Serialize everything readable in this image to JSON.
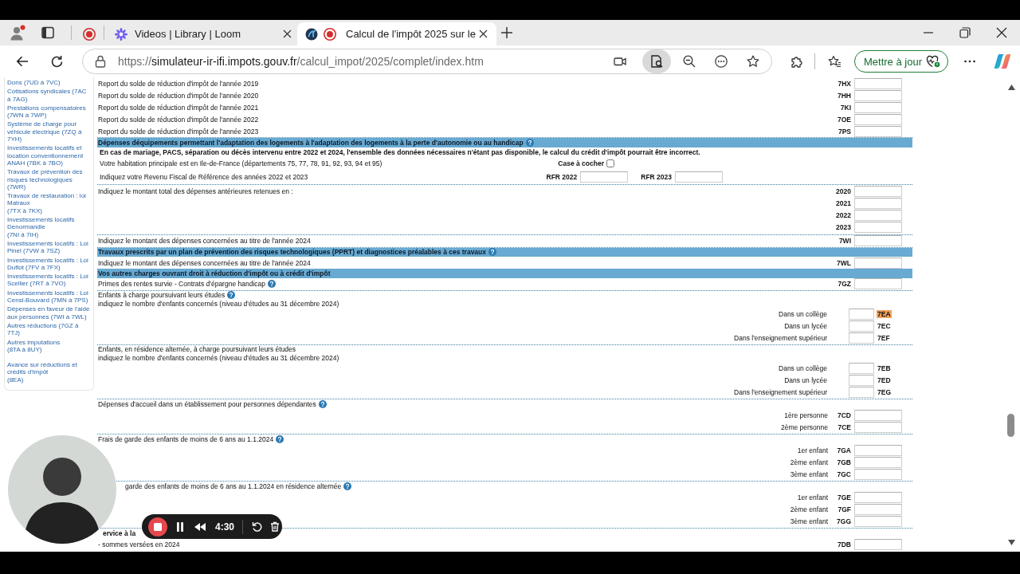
{
  "browser": {
    "tabs": [
      {
        "kind": "pinned",
        "recording": true,
        "selected": false
      },
      {
        "kind": "page",
        "title": "Videos | Library | Loom",
        "recording": false,
        "selected": false
      },
      {
        "kind": "page",
        "title": "Calcul de l'impôt 2025 sur le",
        "recording": true,
        "selected": true
      }
    ],
    "url": {
      "scheme": "https://",
      "host": "simulateur-ir-ifi.impots.gouv.fr",
      "path": "/calcul_impot/2025/complet/index.htm"
    },
    "update_button": "Mettre à jour"
  },
  "sidebar": {
    "sections": [
      {
        "items": [
          "Dons (7UD à 7VC)",
          "Cotisations syndicales (7AC à 7AG)",
          "Prestations compensatoires (7WN à 7WP)",
          "Système de charge pour véhicule électrique (7ZQ à 7YH)",
          "Investissements locatifs et location conventionnement ANAH (7BK à 7BO)",
          "Travaux de prévention des risques technologiques (7WR)",
          "Travaux de restauration : loi Malraux\n(7TX à 7KX)",
          "Investissements locatifs Denormandie\n(7NI à 7IH)",
          "Investissements locatifs : Loi Pinel (7VW à 7SZ)",
          "Investissements locatifs : Loi Duflot (7FV à 7FX)",
          "Investissements locatifs : Loi Scellier (7RT à 7VO)",
          "Investissements locatifs : Loi Censi-Bouvard (7MN à 7PS)",
          "Dépenses en faveur de l'aide aux personnes (7WI à 7WL)",
          "Autres réductions (7GZ à 7TJ)",
          "Autres imputations\n(8TA à 8UY)"
        ]
      },
      {
        "items": [
          "Avance sur réductions et crédits d'impôt\n(8EA)"
        ]
      }
    ]
  },
  "form": {
    "groups": [
      {
        "rows": [
          {
            "kind": "field",
            "label": "Report du solde de réduction d'impôt de l'année 2019",
            "code": "7HX"
          },
          {
            "kind": "field",
            "label": "Report du solde de réduction d'impôt de l'année 2020",
            "code": "7HH"
          },
          {
            "kind": "field",
            "label": "Report du solde de réduction d'impôt de l'année 2021",
            "code": "7KI"
          },
          {
            "kind": "field",
            "label": "Report du solde de réduction d'impôt de l'année 2022",
            "code": "7OE"
          },
          {
            "kind": "field",
            "label": "Report du solde de réduction d'impôt de l'année 2023",
            "code": "7PS"
          }
        ]
      },
      {
        "rows": [
          {
            "kind": "header",
            "title": "Dépenses déquipements permettant l'adaptation des logements à l'adaptation des logements à la perte d'autonomie ou au handicap",
            "help": true
          },
          {
            "kind": "notice",
            "text": "En cas de mariage, PACS, séparation ou décès intervenu entre 2022 et 2024, l'ensemble des données nécessaires n'étant pas disponible, le calcul du crédit d'impôt pourrait être incorrect."
          },
          {
            "kind": "checkbox",
            "label": "Votre habitation principale est en Ile-de-France (départements 75, 77, 78, 91, 92, 93, 94 et 95)",
            "checkbox_label": "Case à cocher",
            "checked": false
          },
          {
            "kind": "rfr",
            "label": "Indiquez votre Revenu Fiscal de Référence des années 2022 et 2023",
            "fields": [
              "RFR 2022",
              "RFR 2023"
            ]
          }
        ]
      },
      {
        "rows": [
          {
            "kind": "years",
            "label": "Indiquez le montant total des dépenses antérieures retenues en :",
            "years": [
              "2020",
              "2021",
              "2022",
              "2023"
            ]
          }
        ]
      },
      {
        "rows": [
          {
            "kind": "field",
            "label": "Indiquez le montant des dépenses concernées au titre de l'année 2024",
            "code": "7WI"
          }
        ]
      },
      {
        "rows": [
          {
            "kind": "header",
            "title": "Travaux prescrits par un plan de prévention des risques technologiques (PPRT) et diagnostices préalables à ces travaux",
            "help": true
          },
          {
            "kind": "field",
            "label": "Indiquez le montant des dépenses concernées au titre de l'année 2024",
            "code": "7WL"
          },
          {
            "kind": "header",
            "title": "Vos autres charges ouvrant droit à réduction d'impôt ou à crédit d'impôt",
            "help": false
          },
          {
            "kind": "field",
            "label": "Primes des rentes survie - Contrats d'épargne handicap",
            "code": "7GZ",
            "help": true
          }
        ]
      },
      {
        "rows": [
          {
            "kind": "title",
            "text": "Enfants à charge poursuivant leurs études",
            "help": true
          },
          {
            "kind": "subtitle",
            "text": "indiquez le nombre d'enfants concernés (niveau d'études au 31 décembre 2024)"
          },
          {
            "kind": "count",
            "label": "Dans un collège",
            "code": "7EA",
            "highlighted": true
          },
          {
            "kind": "count",
            "label": "Dans un lycée",
            "code": "7EC",
            "highlighted": false
          },
          {
            "kind": "count",
            "label": "Dans l'enseignement supérieur",
            "code": "7EF",
            "highlighted": false
          }
        ]
      },
      {
        "rows": [
          {
            "kind": "title",
            "text": "Enfants, en résidence alternée, à charge poursuivant leurs études",
            "help": false
          },
          {
            "kind": "subtitle",
            "text": "indiquez le nombre d'enfants concernés (niveau d'études au 31 décembre 2024)"
          },
          {
            "kind": "count",
            "label": "Dans un collège",
            "code": "7EB",
            "highlighted": false
          },
          {
            "kind": "count",
            "label": "Dans un lycée",
            "code": "7ED",
            "highlighted": false
          },
          {
            "kind": "count",
            "label": "Dans l'enseignement supérieur",
            "code": "7EG",
            "highlighted": false
          }
        ]
      },
      {
        "rows": [
          {
            "kind": "title",
            "text": "Dépenses d'accueil dans un établissement pour personnes dépendantes",
            "help": true
          },
          {
            "kind": "sub_field",
            "label": "1ère personne",
            "code": "7CD"
          },
          {
            "kind": "sub_field",
            "label": "2ème personne",
            "code": "7CE"
          }
        ]
      },
      {
        "rows": [
          {
            "kind": "title",
            "text": "Frais de garde des enfants de moins de 6 ans au 1.1.2024",
            "help": true
          },
          {
            "kind": "sub_field",
            "label": "1er enfant",
            "code": "7GA"
          },
          {
            "kind": "sub_field",
            "label": "2ème enfant",
            "code": "7GB"
          },
          {
            "kind": "sub_field",
            "label": "3ème enfant",
            "code": "7GC"
          }
        ]
      },
      {
        "rows": [
          {
            "kind": "title",
            "text": "garde des enfants de moins de 6 ans au 1.1.2024 en résidence alternée",
            "help": true,
            "partly_hidden": true
          },
          {
            "kind": "sub_field",
            "label": "1er enfant",
            "code": "7GE"
          },
          {
            "kind": "sub_field",
            "label": "2ème enfant",
            "code": "7GF"
          },
          {
            "kind": "sub_field",
            "label": "3ème enfant",
            "code": "7GG"
          }
        ]
      },
      {
        "rows": [
          {
            "kind": "bold",
            "text": "ervice à la",
            "partly_hidden": true
          },
          {
            "kind": "field",
            "label": "- sommes versées en 2024",
            "code": "7DB"
          }
        ]
      }
    ]
  },
  "recording": {
    "time": "4:30"
  }
}
